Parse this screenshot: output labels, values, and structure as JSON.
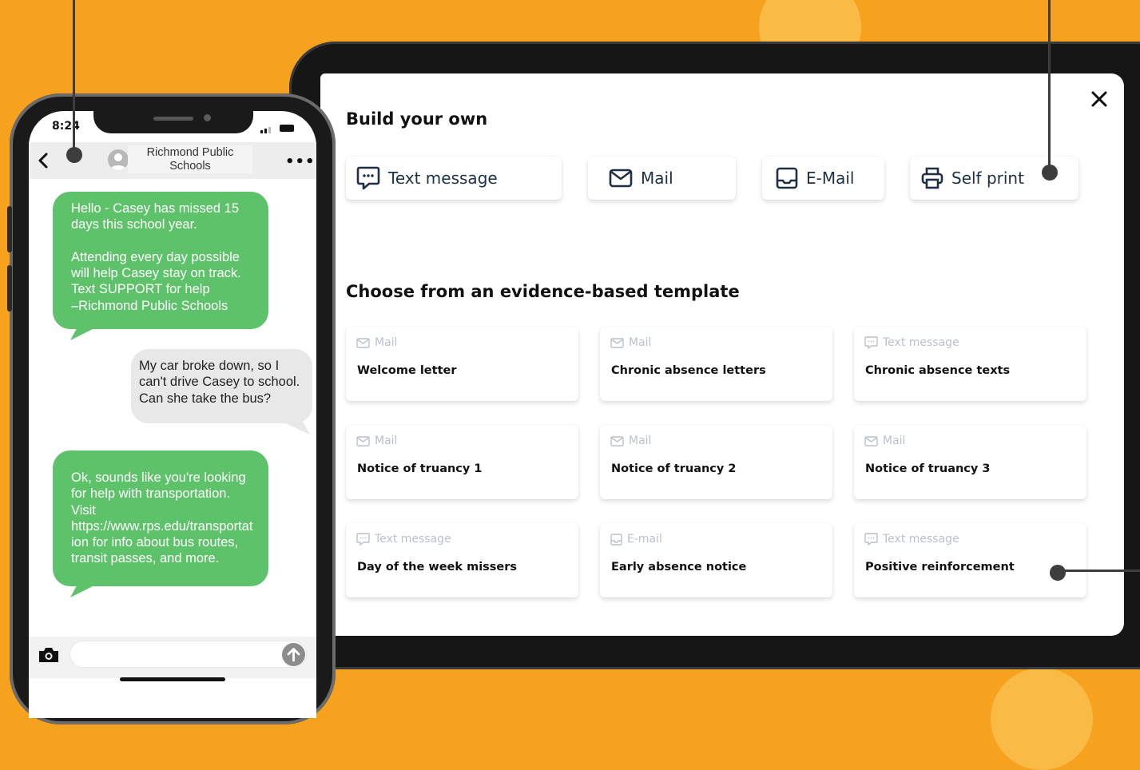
{
  "colors": {
    "background": "#F6A21E",
    "bubble_green": "#5ec26a",
    "bubble_gray": "#e8e8e8",
    "channel_icon": "#1f2f44",
    "template_meta": "#b9c1c9",
    "callout": "#3d3d3d"
  },
  "phone": {
    "status_time": "8:24",
    "contact_name": "Richmond Public Schools",
    "messages": [
      {
        "from": "school",
        "text": "Hello - Casey has missed 15 days this school year.\n\nAttending every day possible will help Casey stay on track. Text SUPPORT for help\n–Richmond Public Schools"
      },
      {
        "from": "parent",
        "text": "My car broke down, so I can't drive Casey to school. Can she take the bus?"
      },
      {
        "from": "school",
        "text": "Ok, sounds like you're looking for help with transportation. Visit https://www.rps.edu/transportat ion for info about bus routes, transit passes, and more."
      }
    ],
    "icons": {
      "back": "chevron-left-icon",
      "more": "more-dots-icon",
      "camera": "camera-icon",
      "send": "arrow-up-icon",
      "avatar": "person-icon"
    }
  },
  "panel": {
    "build_title": "Build your own",
    "channels": [
      {
        "label": "Text message",
        "icon": "chat-bubble-icon"
      },
      {
        "label": "Mail",
        "icon": "envelope-icon"
      },
      {
        "label": "E-Mail",
        "icon": "inbox-icon"
      },
      {
        "label": "Self print",
        "icon": "printer-icon"
      }
    ],
    "template_title": "Choose from an evidence-based template",
    "templates": [
      {
        "type": "Mail",
        "name": "Welcome letter"
      },
      {
        "type": "Mail",
        "name": "Chronic absence letters"
      },
      {
        "type": "Text message",
        "name": "Chronic absence texts"
      },
      {
        "type": "Mail",
        "name": "Notice of truancy 1"
      },
      {
        "type": "Mail",
        "name": "Notice of truancy 2"
      },
      {
        "type": "Mail",
        "name": "Notice of truancy 3"
      },
      {
        "type": "Text message",
        "name": "Day of the week missers"
      },
      {
        "type": "E-mail",
        "name": "Early absence notice"
      },
      {
        "type": "Text message",
        "name": "Positive reinforcement"
      }
    ],
    "close_icon": "close-icon"
  }
}
